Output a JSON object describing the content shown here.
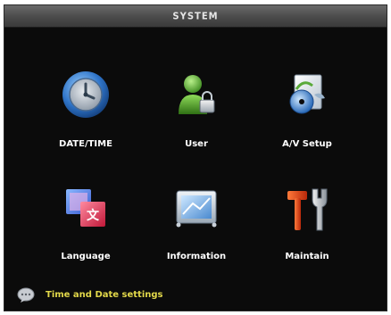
{
  "window": {
    "title": "SYSTEM"
  },
  "menu": [
    {
      "label": "DATE/TIME",
      "icon": "clock-icon"
    },
    {
      "label": "User",
      "icon": "user-icon"
    },
    {
      "label": "A/V Setup",
      "icon": "av-setup-icon"
    },
    {
      "label": "Language",
      "icon": "language-icon"
    },
    {
      "label": "Information",
      "icon": "information-icon"
    },
    {
      "label": "Maintain",
      "icon": "maintain-icon"
    }
  ],
  "status": {
    "text": "Time and Date settings",
    "icon": "chat-bubble-icon"
  },
  "colors": {
    "background": "#0b0b0b",
    "status_text": "#e2d84a",
    "label_text": "#ffffff"
  }
}
